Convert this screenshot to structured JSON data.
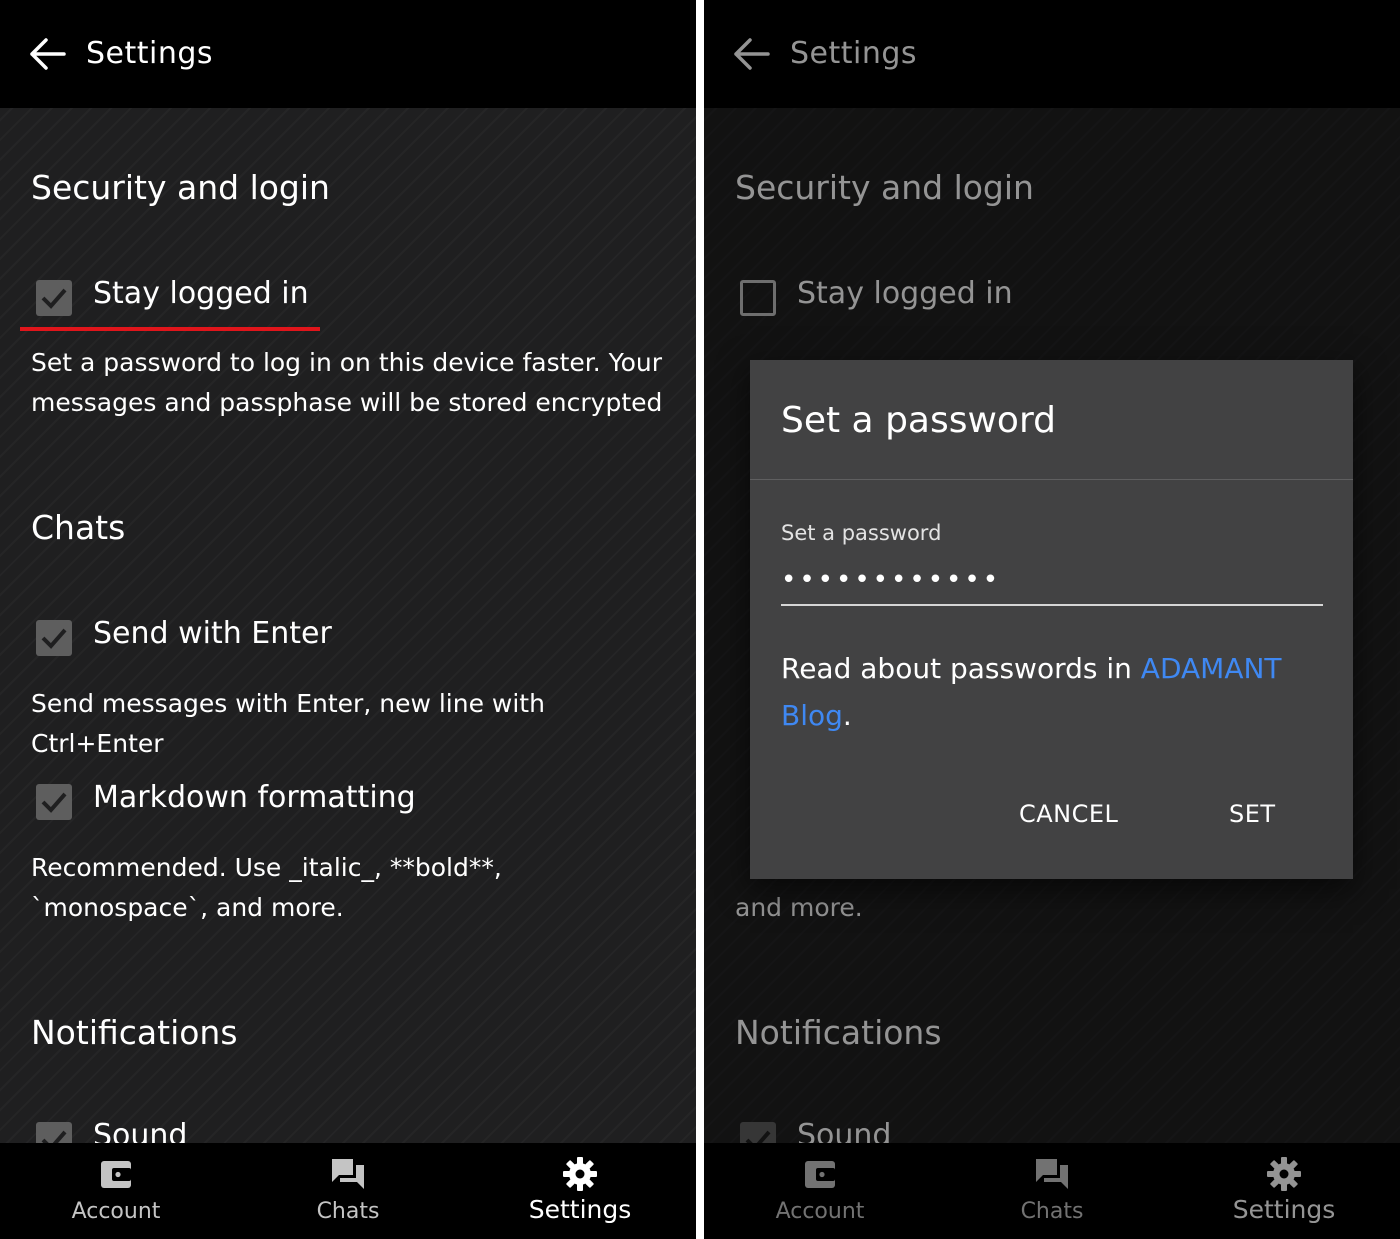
{
  "left": {
    "appbar": {
      "title": "Settings"
    },
    "sections": {
      "security": "Security and login",
      "chats": "Chats",
      "notifications": "Notifications"
    },
    "items": {
      "stay_logged_in": {
        "label": "Stay logged in",
        "checked": true,
        "description": "Set a password to log in on this device faster. Your messages and passphase will be stored encrypted"
      },
      "send_with_enter": {
        "label": "Send with Enter",
        "checked": true,
        "description": "Send messages with Enter, new line with Ctrl+Enter"
      },
      "markdown": {
        "label": "Markdown formatting",
        "checked": true,
        "description": "Recommended. Use _italic_, **bold**, `monospace`, and more."
      },
      "sound": {
        "label": "Sound",
        "checked": true
      }
    },
    "annotation_color": "#e0151b"
  },
  "right": {
    "appbar": {
      "title": "Settings"
    },
    "sections": {
      "security": "Security and login",
      "notifications": "Notifications"
    },
    "items": {
      "stay_logged_in": {
        "label": "Stay logged in",
        "checked": false
      },
      "markdown_tail": "and more.",
      "sound": {
        "label": "Sound"
      }
    },
    "dialog": {
      "title": "Set a password",
      "field_label": "Set a password",
      "field_value": "••••••••••••",
      "text_before": "Read about passwords in ",
      "link_text": "ADAMANT Blog",
      "text_after": ".",
      "cancel": "CANCEL",
      "confirm": "SET",
      "link_color": "#3f88f2"
    }
  },
  "bottom_nav": {
    "account": "Account",
    "chats": "Chats",
    "settings": "Settings"
  }
}
